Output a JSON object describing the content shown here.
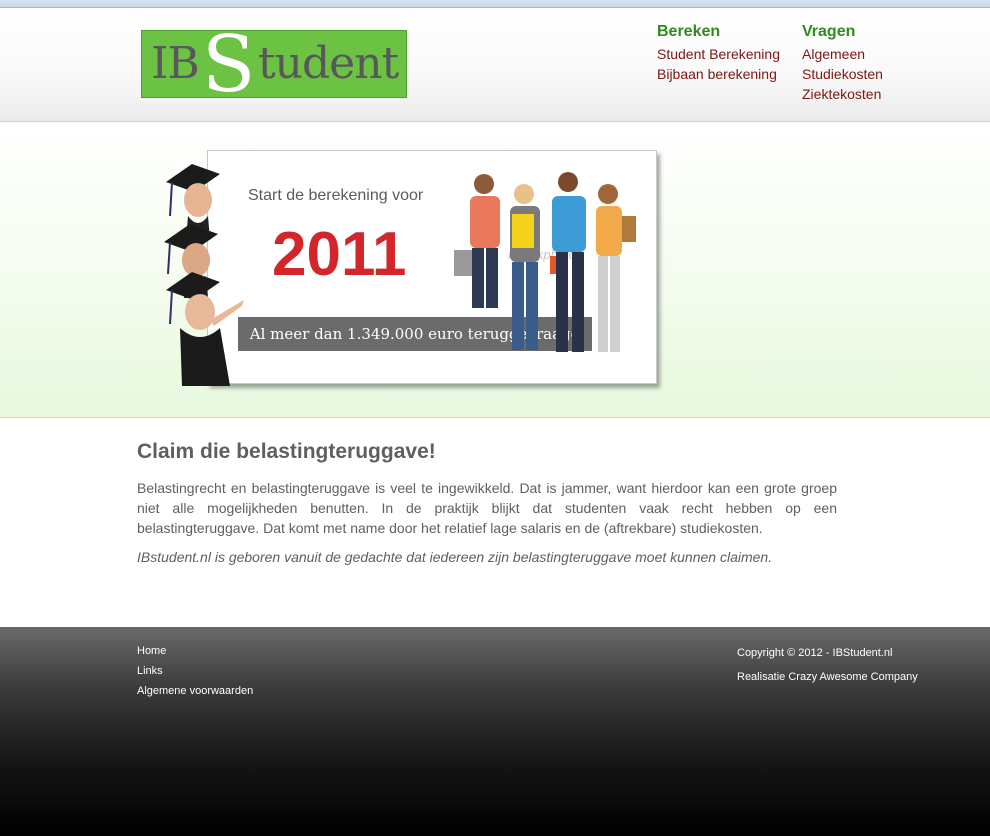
{
  "header": {
    "logo": {
      "prefix": "IB",
      "big_letter": "S",
      "suffix": "tudent"
    },
    "nav": {
      "bereken": {
        "heading": "Bereken",
        "items": [
          "Student Berekening",
          "Bijbaan berekening"
        ]
      },
      "vragen": {
        "heading": "Vragen",
        "items": [
          "Algemeen",
          "Studiekosten",
          "Ziektekosten"
        ]
      }
    }
  },
  "banner": {
    "lead": "Start de berekening voor",
    "year": "2011",
    "claim": "Al meer dan 1.349.000 euro teruggevraagd",
    "watermark": "iStockphoto"
  },
  "main": {
    "title": "Claim die belastingteruggave!",
    "paragraph": "Belastingrecht en belastingteruggave is veel te ingewikkeld. Dat is jammer, want hierdoor kan een grote groep niet alle mogelijkheden benutten. In de praktijk blijkt dat studenten vaak recht hebben op een belastingteruggave. Dat komt met name door het relatief lage salaris en de (aftrekbare) studiekosten.",
    "italic": "IBstudent.nl is geboren vanuit de gedachte dat iedereen zijn belastingteruggave moet kunnen claimen."
  },
  "footer": {
    "links": [
      "Home",
      "Links",
      "Algemene voorwaarden"
    ],
    "copyright": "Copyright © 2012 - IBStudent.nl",
    "credit": "Realisatie Crazy Awesome Company"
  },
  "colors": {
    "logo_green": "#6cc242",
    "nav_heading": "#2f8a1f",
    "nav_link": "#7d1712",
    "year_red": "#d3262b"
  }
}
